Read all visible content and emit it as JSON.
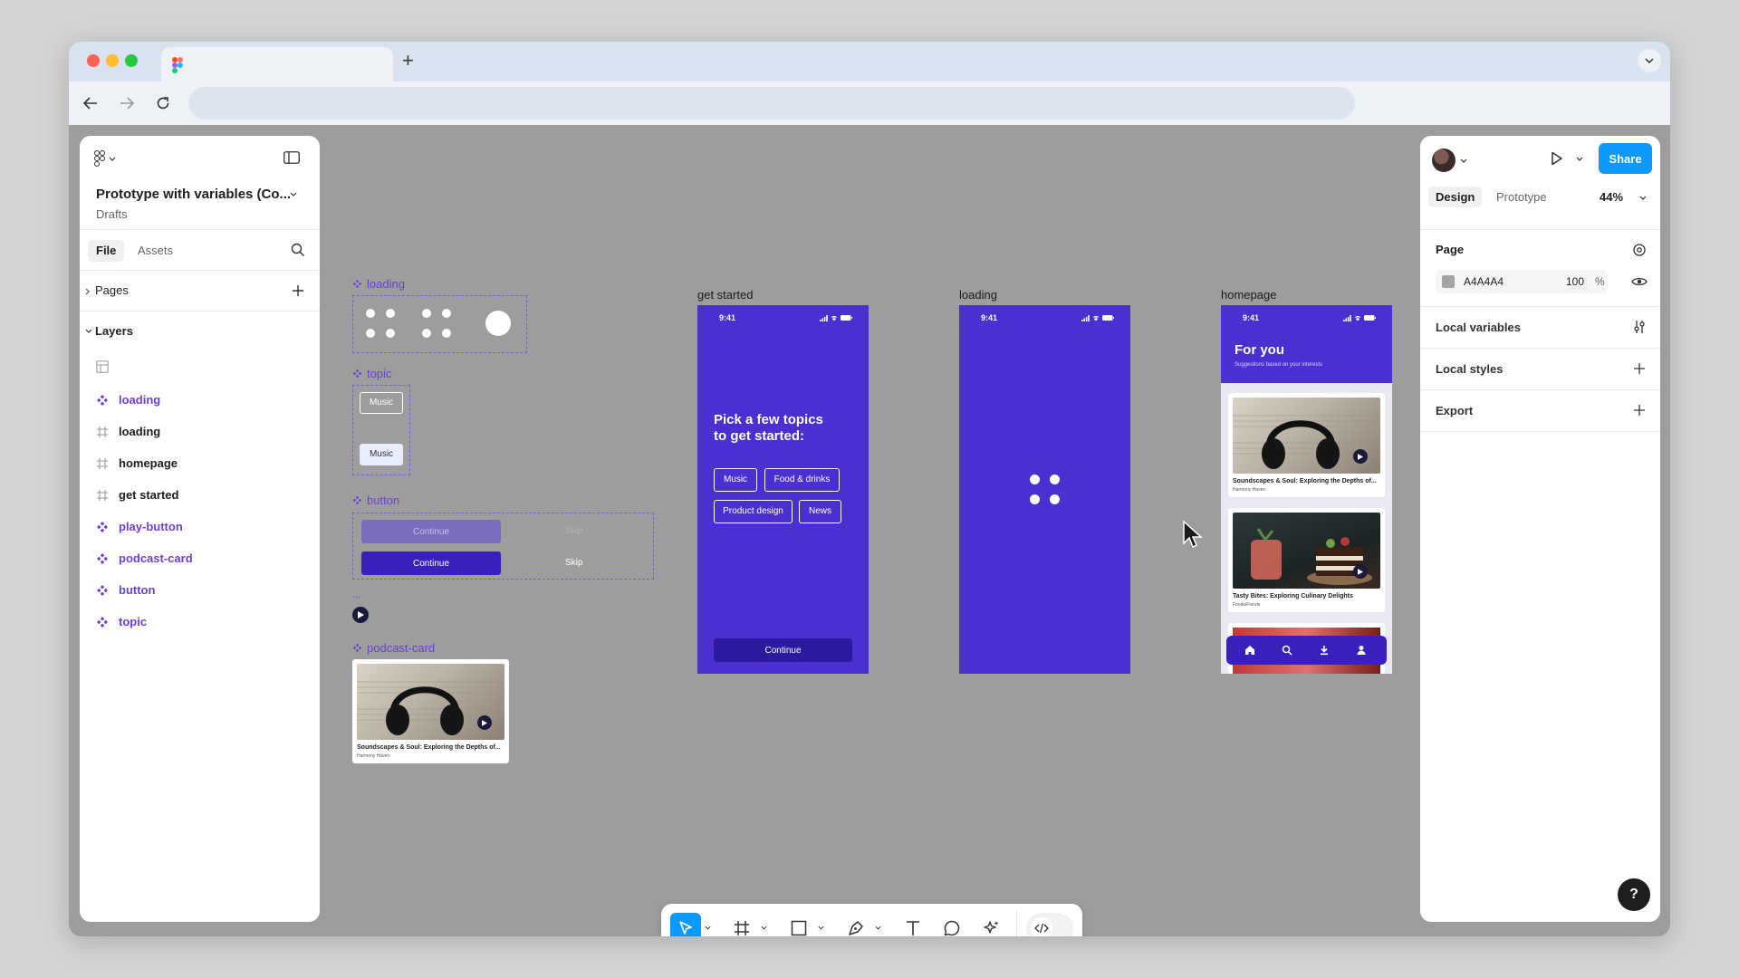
{
  "browser": {
    "tab_title": "",
    "new_tab": "+",
    "url": ""
  },
  "left_panel": {
    "file_name": "Prototype with variables (Co...",
    "location": "Drafts",
    "tabs": [
      "File",
      "Assets"
    ],
    "pages_label": "Pages",
    "layers_label": "Layers",
    "layers": [
      {
        "name": "loading",
        "kind": "component"
      },
      {
        "name": "loading",
        "kind": "frame"
      },
      {
        "name": "homepage",
        "kind": "frame"
      },
      {
        "name": "get started",
        "kind": "frame"
      },
      {
        "name": "play-button",
        "kind": "component"
      },
      {
        "name": "podcast-card",
        "kind": "component"
      },
      {
        "name": "button",
        "kind": "component"
      },
      {
        "name": "topic",
        "kind": "component"
      }
    ]
  },
  "right_panel": {
    "share_label": "Share",
    "tabs": [
      "Design",
      "Prototype"
    ],
    "zoom": "44%",
    "page_label": "Page",
    "page_color": "A4A4A4",
    "page_opacity": "100",
    "percent": "%",
    "rows": [
      "Local variables",
      "Local styles",
      "Export"
    ],
    "help": "?"
  },
  "canvas": {
    "components": {
      "loading": "loading",
      "topic": "topic",
      "button": "button",
      "ellipsis": "...",
      "podcast_card": "podcast-card"
    },
    "topic_chips": [
      "Music",
      "Music"
    ],
    "button_variants": {
      "continue_disabled": "Continue",
      "skip_disabled": "Skip",
      "continue": "Continue",
      "skip": "Skip"
    },
    "podcast_card": {
      "title": "Soundscapes & Soul: Exploring the Depths of...",
      "author": "Harmony Haven"
    },
    "frames": {
      "get_started": {
        "label": "get started",
        "time": "9:41",
        "heading_line1": "Pick a few topics",
        "heading_line2": "to get started:",
        "chips": [
          "Music",
          "Food & drinks",
          "Product design",
          "News"
        ],
        "continue": "Continue"
      },
      "loading": {
        "label": "loading",
        "time": "9:41"
      },
      "homepage": {
        "label": "homepage",
        "time": "9:41",
        "title": "For you",
        "subtitle": "Suggestions based on your interests",
        "cards": [
          {
            "title": "Soundscapes & Soul: Exploring the Depths of...",
            "author": "Harmony Haven"
          },
          {
            "title": "Tasty Bites: Exploring Culinary Delights",
            "author": "FoodieFiends"
          }
        ]
      }
    }
  },
  "colors": {
    "canvas_bg": "#9d9d9d",
    "frame_purple": "#4b2fd1",
    "component_purple": "#6b40d6",
    "accent_blue": "#0d99ff",
    "button_dark": "#2a1aa0"
  },
  "icons": {
    "traffic_lights": [
      "close",
      "minimize",
      "maximize"
    ],
    "toolbar": [
      "move-tool",
      "frame-tool",
      "shape-tool",
      "pen-tool",
      "text-tool",
      "comment-tool",
      "actions-tool",
      "dev-mode-toggle"
    ]
  }
}
